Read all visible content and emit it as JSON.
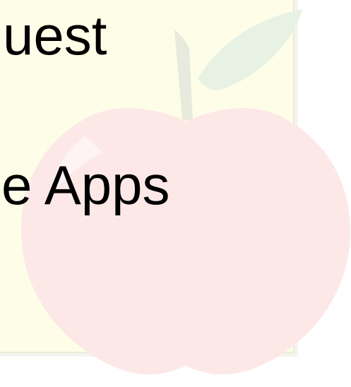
{
  "text": {
    "line_1": "uest",
    "line_2": "e Apps"
  },
  "icons": {
    "background": "apple-icon"
  },
  "colors": {
    "background": "#ffffff",
    "note_panel": "#fefee8",
    "text": "#000000",
    "apple": "#fde8e8",
    "leaf": "#e8f2e4",
    "stem": "#e7eadd"
  }
}
